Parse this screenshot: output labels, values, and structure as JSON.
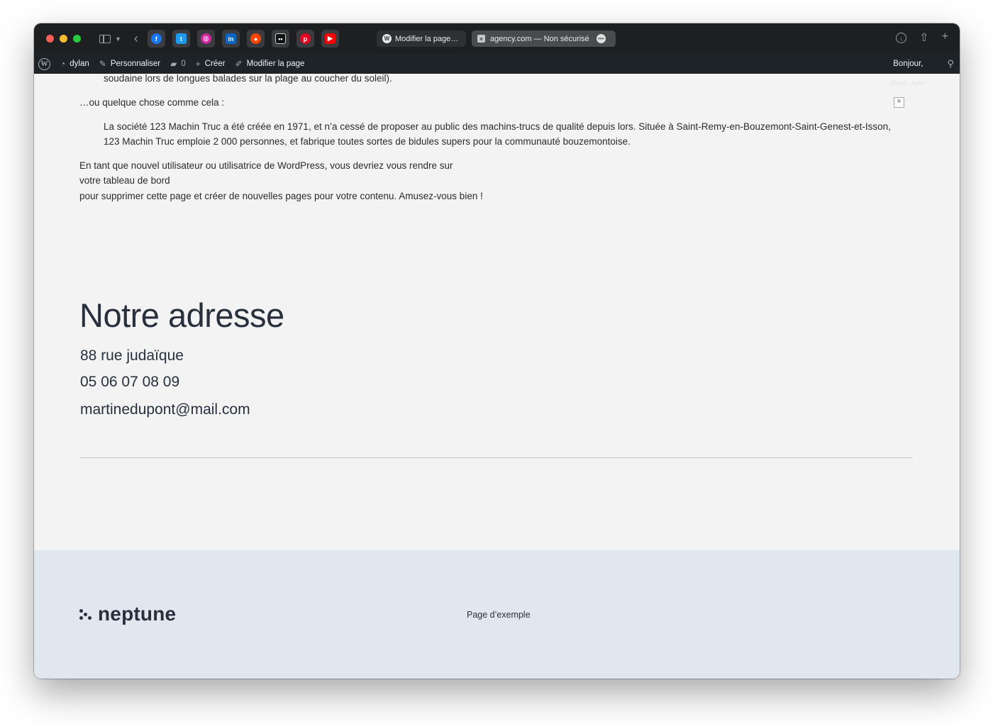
{
  "browser": {
    "tabs": [
      {
        "label": "Modifier la page…"
      },
      {
        "label": "agency.com — Non sécurisé"
      }
    ],
    "favorites": [
      "facebook-icon",
      "twitter-icon",
      "instagram-icon",
      "linkedin-icon",
      "reddit-icon",
      "flickr-icon",
      "pinterest-icon",
      "youtube-icon"
    ]
  },
  "adminbar": {
    "site": "dylan",
    "customize": "Personnaliser",
    "comments": "0",
    "new": "Créer",
    "edit": "Modifier la page",
    "greeting": "Bonjour,",
    "user_faint": "Dylan_dylan"
  },
  "content": {
    "quote_tail": "soudaine lors de longues balades sur la plage au coucher du soleil).",
    "or_something": "…ou quelque chose comme cela :",
    "quote2_line1": "La société 123 Machin Truc a été créée en 1971, et n’a cessé de proposer au public des machins-trucs de qualité depuis lors. Située à Saint-Remy-en-Bouzemont-Saint-Genest-et-Isson,",
    "quote2_line2": "123 Machin Truc emploie 2 000 personnes, et fabrique toutes sortes de bidules supers pour la communauté bouzemontoise.",
    "wp_line1": "En tant que nouvel utilisateur ou utilisatrice de WordPress, vous devriez vous rendre sur",
    "wp_line2": "votre tableau de bord",
    "wp_line3": "pour supprimer cette page et créer de nouvelles pages pour votre contenu. Amusez-vous bien !",
    "heading": "Notre adresse",
    "street": "88 rue judaïque",
    "phone": "05 06 07 08 09",
    "email": "martinedupont@mail.com"
  },
  "footer": {
    "brand": "neptune",
    "link": "Page d’exemple"
  },
  "colors": {
    "toolbar": "#1e1f21",
    "adminbar": "#1d2327",
    "page_bg": "#f3f3f3",
    "footer_bg": "#e1e7ee",
    "text": "#28303d"
  }
}
